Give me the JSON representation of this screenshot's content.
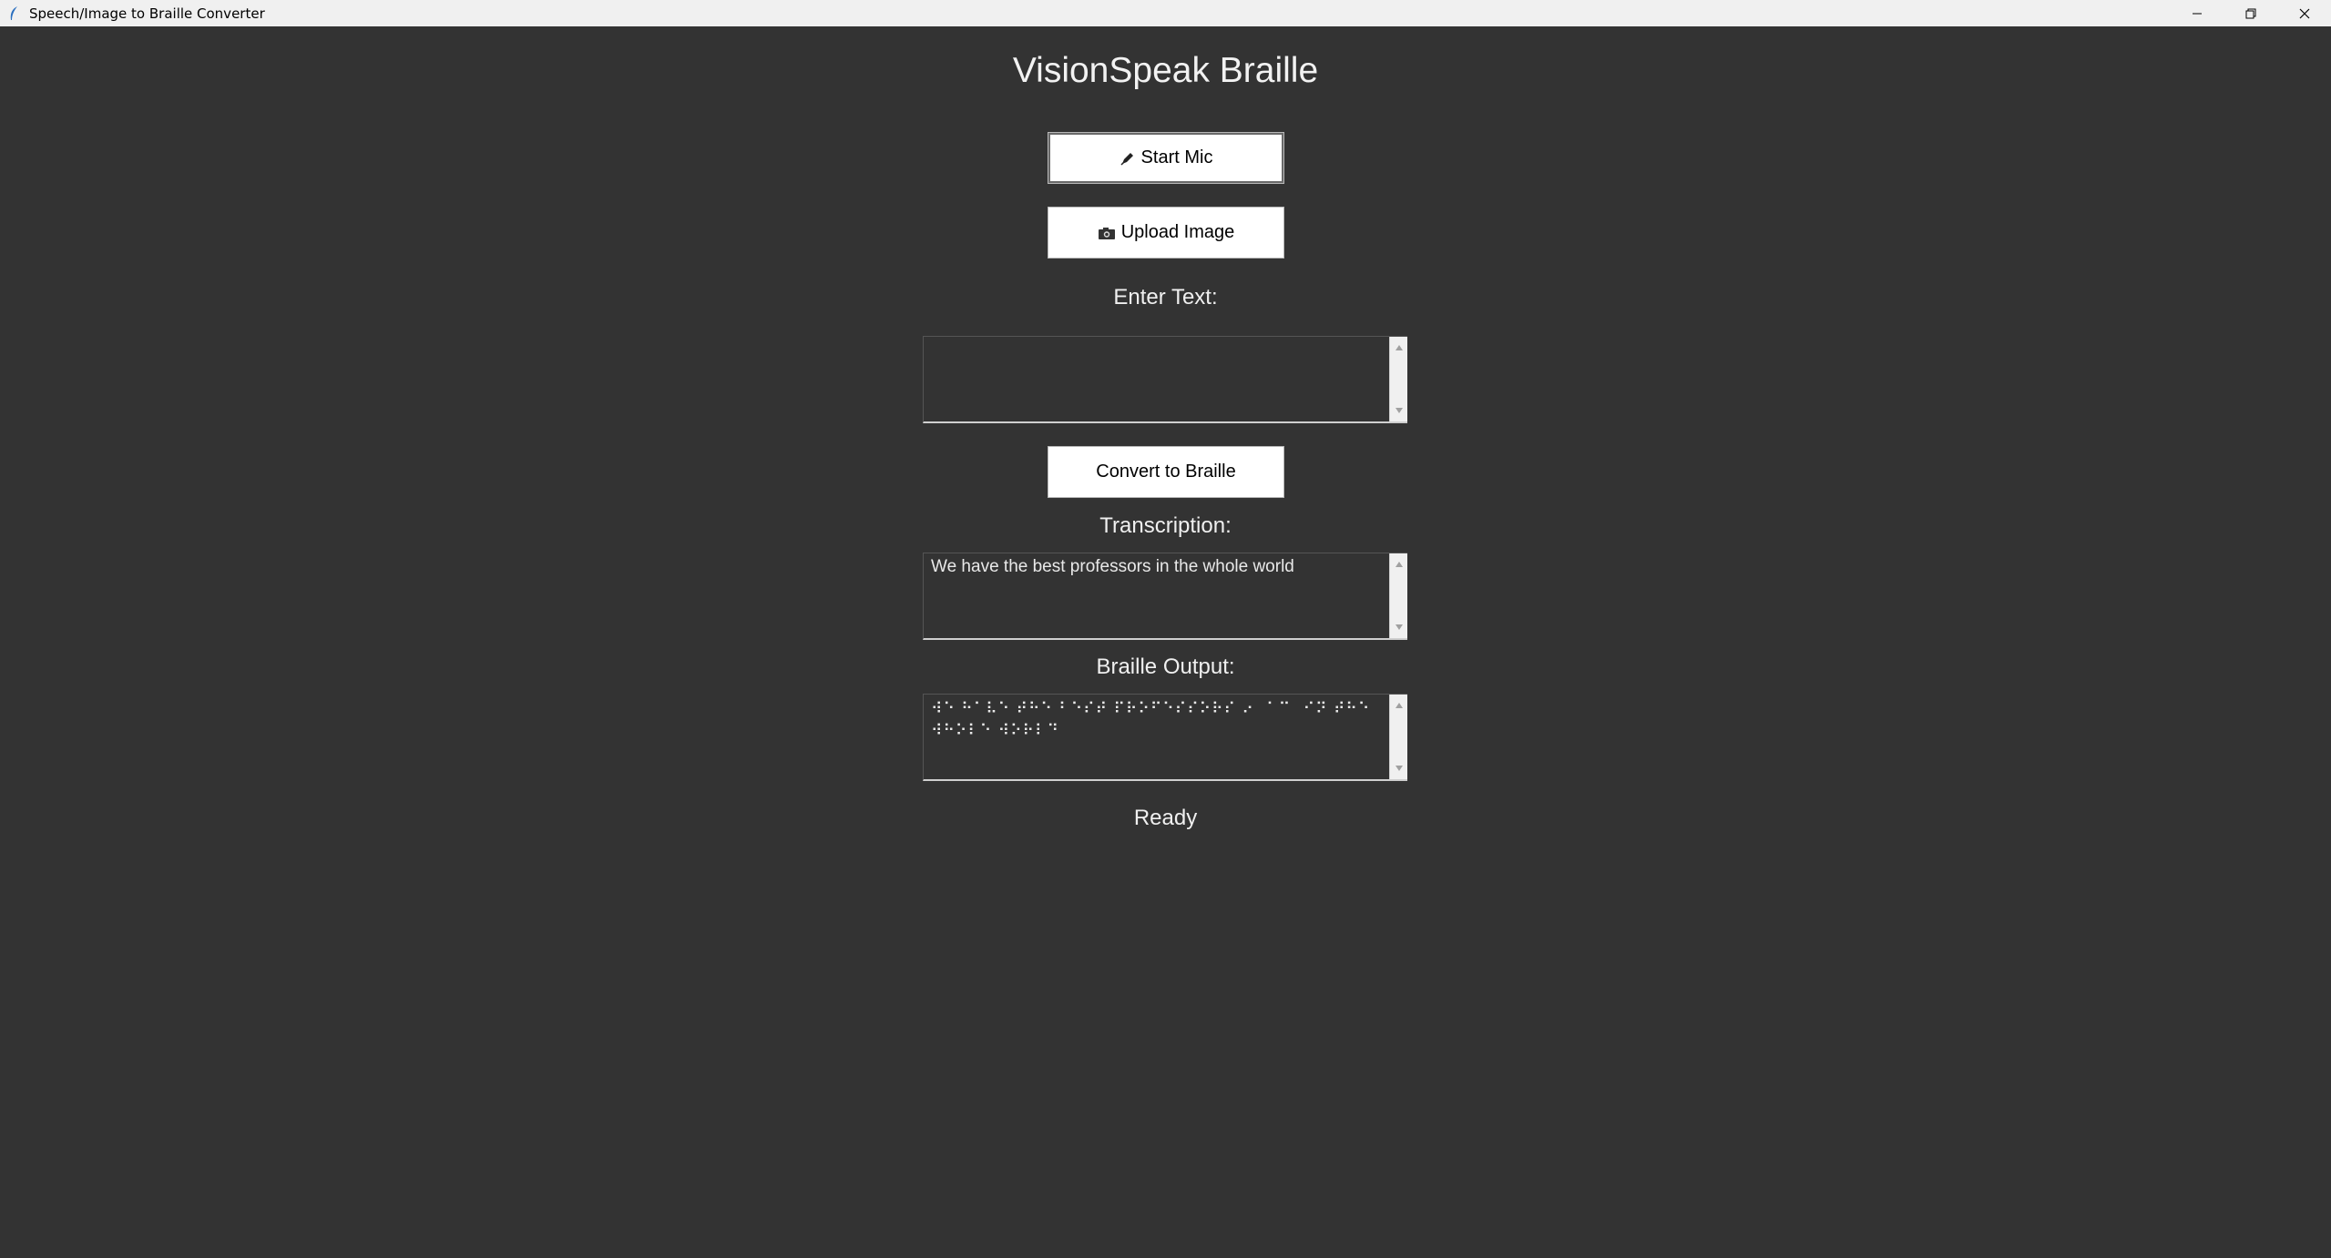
{
  "window": {
    "title": "Speech/Image to Braille Converter",
    "controls": {
      "minimize": "–",
      "restore": "❐",
      "close": "✕"
    }
  },
  "app": {
    "heading": "VisionSpeak Braille"
  },
  "buttons": {
    "start_mic": {
      "icon": "✎",
      "label": "Start Mic"
    },
    "upload_image": {
      "icon": "📷",
      "label": "Upload Image"
    },
    "convert": {
      "label": "Convert to Braille"
    }
  },
  "labels": {
    "enter_text": "Enter Text:",
    "transcription": "Transcription:",
    "braille_output": "Braille Output:"
  },
  "fields": {
    "enter_text_value": "",
    "transcription_value": "We have the best professors in the whole world",
    "braille_value": "⠺⠑ ⠓⠁⠧⠑ ⠞⠓⠑ ⠃⠑⠎⠞ ⠏⠗⠕⠋⠑⠎⠎⠕⠗⠎ ⠔⠀⠁⠉⠀⠊⠝ ⠞⠓⠑ ⠺⠓⠕⠇⠑ ⠺⠕⠗⠇⠙"
  },
  "status": "Ready"
}
